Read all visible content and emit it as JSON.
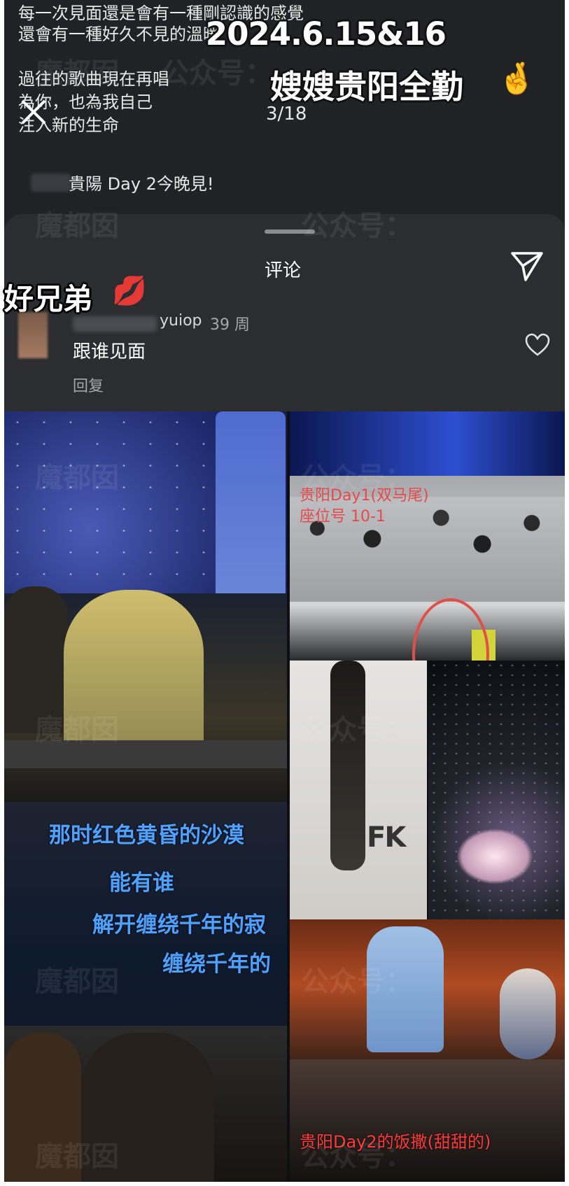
{
  "story": {
    "caption_lines": [
      "每一次見面還是會有一種剛認識的感覺",
      "還會有一種好久不見的溫暖",
      "過往的歌曲現在再唱",
      "為你，也為我自己",
      "注入新的生命",
      "貴陽 Day 2今晚見!"
    ],
    "counter": "3/18",
    "overlay_date": "2024.6.15&16",
    "overlay_title": "嫂嫂贵阳全勤"
  },
  "comments_sheet": {
    "title": "评论",
    "overlay_label": "好兄弟",
    "comment": {
      "username_suffix": "yuiop",
      "time": "39 周",
      "text": "跟谁见面",
      "reply_label": "回复"
    }
  },
  "collage": {
    "lyrics": [
      "那时红色黄昏的沙漠",
      "能有谁",
      "解开缠绕千年的寂",
      "缠绕千年的"
    ],
    "day1_line1": "贵阳Day1(双马尾)",
    "day1_line2": "座位号 10-1",
    "shirt_text": "FK",
    "day2_caption": "贵阳Day2的饭撒(甜甜的)"
  },
  "watermark": {
    "left_text": "魔都囡",
    "right_text": "公众号："
  }
}
